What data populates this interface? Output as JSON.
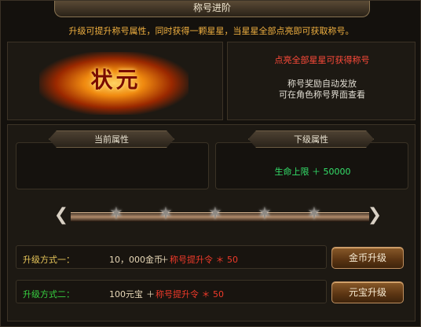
{
  "title": "称号进阶",
  "notice": "升级可提升称号属性，同时获得一颗星星，当星星全部点亮即可获取称号。",
  "badge": {
    "text": "状元"
  },
  "reward": {
    "hint": "点亮全部星星可获得称号",
    "line1": "称号奖励自动发放",
    "line2": "可在角色称号界面查看"
  },
  "current_attr": {
    "header": "当前属性"
  },
  "next_attr": {
    "header": "下级属性",
    "value": "生命上限 ＋ 50000"
  },
  "stars": {
    "total": 5,
    "lit": 0
  },
  "methods": [
    {
      "label": "升级方式一：",
      "cost": "10，000金币",
      "plus": "＋",
      "item": "称号提升令 ＊ 50",
      "button": "金币升级"
    },
    {
      "label": "升级方式二：",
      "cost": "100元宝",
      "plus": "＋",
      "item": "称号提升令 ＊ 50",
      "button": "元宝升级"
    }
  ],
  "colors": {
    "gold_text": "#f0b040",
    "red_text": "#f03a2a",
    "green_text": "#34e06a"
  }
}
